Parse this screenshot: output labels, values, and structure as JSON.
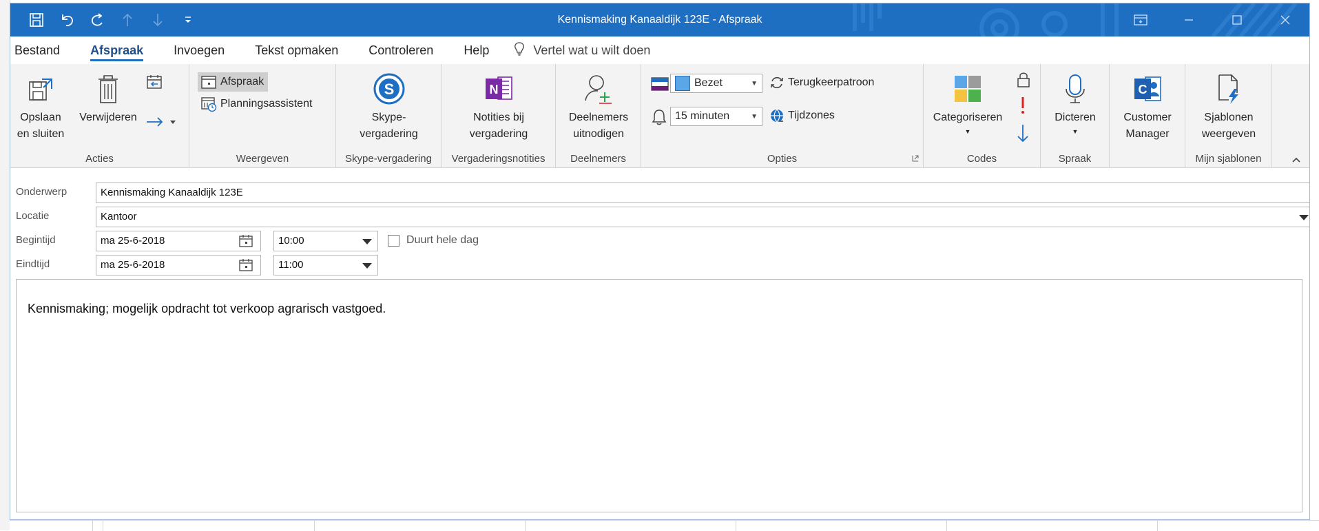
{
  "window": {
    "title": "Kennismaking Kanaaldijk 123E  -  Afspraak"
  },
  "tabs": [
    {
      "label": "Bestand"
    },
    {
      "label": "Afspraak",
      "active": true
    },
    {
      "label": "Invoegen"
    },
    {
      "label": "Tekst opmaken"
    },
    {
      "label": "Controleren"
    },
    {
      "label": "Help"
    }
  ],
  "tellme": {
    "placeholder": "Vertel wat u wilt doen"
  },
  "ribbon": {
    "acties": {
      "label": "Acties",
      "save_line1": "Opslaan",
      "save_line2": "en sluiten",
      "delete": "Verwijderen"
    },
    "weergeven": {
      "label": "Weergeven",
      "afspraak": "Afspraak",
      "planning": "Planningsassistent"
    },
    "skype": {
      "label": "Skype-vergadering",
      "line1": "Skype-",
      "line2": "vergadering"
    },
    "notities": {
      "label": "Vergaderingsnotities",
      "line1": "Notities bij",
      "line2": "vergadering"
    },
    "deelnemers": {
      "label": "Deelnemers",
      "line1": "Deelnemers",
      "line2": "uitnodigen"
    },
    "opties": {
      "label": "Opties",
      "status": "Bezet",
      "reminder": "15 minuten",
      "recurrence": "Terugkeerpatroon",
      "timezones": "Tijdzones"
    },
    "codes": {
      "label": "Codes",
      "categorize": "Categoriseren"
    },
    "spraak": {
      "label": "Spraak",
      "dictate": "Dicteren"
    },
    "customer": {
      "line1": "Customer",
      "line2": "Manager"
    },
    "sjablonen": {
      "label": "Mijn sjablonen",
      "line1": "Sjablonen",
      "line2": "weergeven"
    }
  },
  "form": {
    "subject_label": "Onderwerp",
    "subject": "Kennismaking Kanaaldijk 123E",
    "location_label": "Locatie",
    "location": "Kantoor",
    "start_label": "Begintijd",
    "start_date": "ma 25-6-2018",
    "start_time": "10:00",
    "allday_label": "Duurt hele dag",
    "allday_checked": false,
    "end_label": "Eindtijd",
    "end_date": "ma 25-6-2018",
    "end_time": "11:00",
    "body": "Kennismaking; mogelijk opdracht tot verkoop agrarisch vastgoed."
  },
  "colors": {
    "titlebar": "#1e6fc2",
    "ribbon_bg": "#f3f3f3",
    "accent": "#1e6fc2",
    "onenote": "#7a2aa4",
    "importance_high": "#e02020"
  }
}
